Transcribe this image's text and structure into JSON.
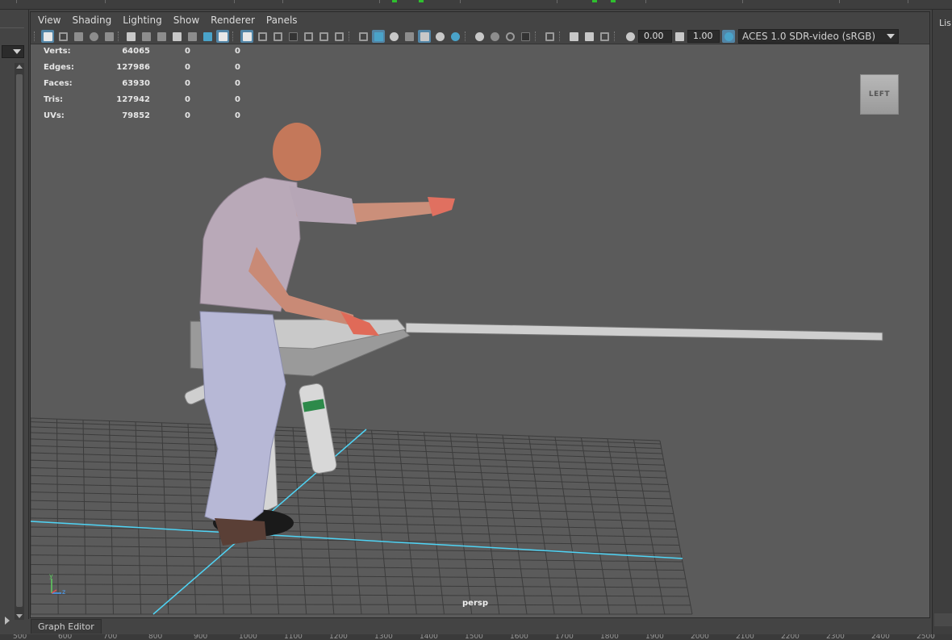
{
  "menubar": {
    "items": [
      "View",
      "Shading",
      "Lighting",
      "Show",
      "Renderer",
      "Panels"
    ]
  },
  "toolbar": {
    "exposure_value": "0.00",
    "gamma_value": "1.00",
    "color_space": "ACES 1.0 SDR-video (sRGB)",
    "icons": [
      "select-camera-icon",
      "lock-camera-icon",
      "camera-attributes-icon",
      "bookmark-icon",
      "image-plane-icon",
      "grid-icon",
      "film-gate-icon",
      "resolution-gate-icon",
      "gate-mask-icon",
      "field-chart-icon",
      "safe-action-icon",
      "safe-title-icon",
      "wireframe-icon",
      "smooth-shade-icon",
      "default-material-icon",
      "xray-icon",
      "textured-icon",
      "use-lights-icon",
      "shadows-icon",
      "ambient-occlusion-icon",
      "motion-blur-icon",
      "anti-alias-icon",
      "depth-of-field-icon",
      "isolate-select-icon",
      "xray-joints-icon",
      "backface-icon",
      "exposure-icon",
      "gamma-icon",
      "color-management-icon"
    ]
  },
  "hud": {
    "rows": [
      {
        "label": "Verts:",
        "v1": "64065",
        "v2": "0",
        "v3": "0"
      },
      {
        "label": "Edges:",
        "v1": "127986",
        "v2": "0",
        "v3": "0"
      },
      {
        "label": "Faces:",
        "v1": "63930",
        "v2": "0",
        "v3": "0"
      },
      {
        "label": "Tris:",
        "v1": "127942",
        "v2": "0",
        "v3": "0"
      },
      {
        "label": "UVs:",
        "v1": "79852",
        "v2": "0",
        "v3": "0"
      }
    ]
  },
  "viewport": {
    "view_cube_label": "LEFT",
    "camera_label": "persp",
    "axis_labels": {
      "y": "y",
      "z": "z"
    }
  },
  "bottom": {
    "graph_editor_tab": "Graph Editor",
    "ruler_labels": [
      "500",
      "600",
      "700",
      "800",
      "900",
      "1000",
      "1100",
      "1200",
      "1300",
      "1400",
      "1500",
      "1600",
      "1700",
      "1800",
      "1900",
      "2000",
      "2100",
      "2200",
      "2300",
      "2400",
      "2500"
    ]
  },
  "right_panel": {
    "label": "Lis"
  },
  "colors": {
    "accent": "#5285a6",
    "grid_axis": "#4fd4f5",
    "viewport_bg": "#5b5b5b",
    "panel_bg": "#444444"
  }
}
